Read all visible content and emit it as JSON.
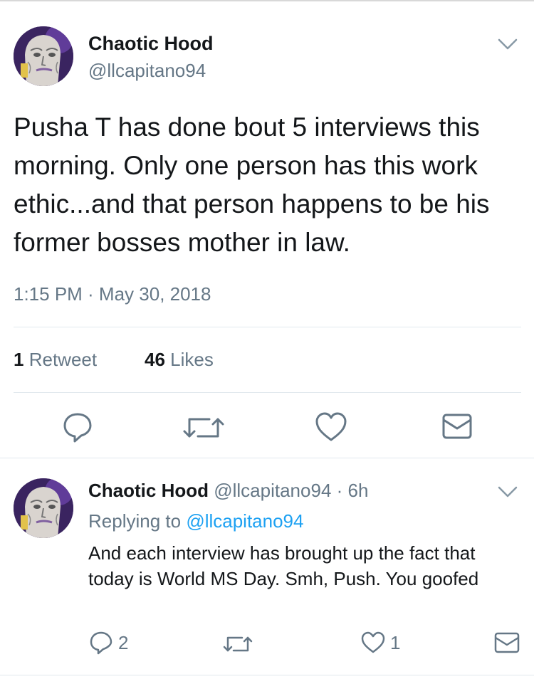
{
  "main_tweet": {
    "author_name": "Chaotic Hood",
    "author_handle": "@llcapitano94",
    "text": "Pusha T has done bout 5 interviews this morning. Only one person has this work ethic...and that person happens to be his former bosses mother in law.",
    "timestamp": "1:15 PM · May 30, 2018",
    "retweet_count": "1",
    "retweet_label": "Retweet",
    "like_count": "46",
    "like_label": "Likes",
    "actions": [
      "reply-icon",
      "retweet-icon",
      "like-icon",
      "share-icon"
    ]
  },
  "reply_tweet": {
    "author_name": "Chaotic Hood",
    "meta": "@llcapitano94 · 6h",
    "replying_prefix": "Replying to",
    "replying_handle": "@llcapitano94",
    "text": "And each interview has brought up the fact that today is World MS Day. Smh, Push. You goofed",
    "reply_count": "2",
    "like_count": "1"
  },
  "colors": {
    "text": "#14171a",
    "secondary": "#657786",
    "link": "#1da1f2",
    "divider": "#e1e8ed"
  }
}
